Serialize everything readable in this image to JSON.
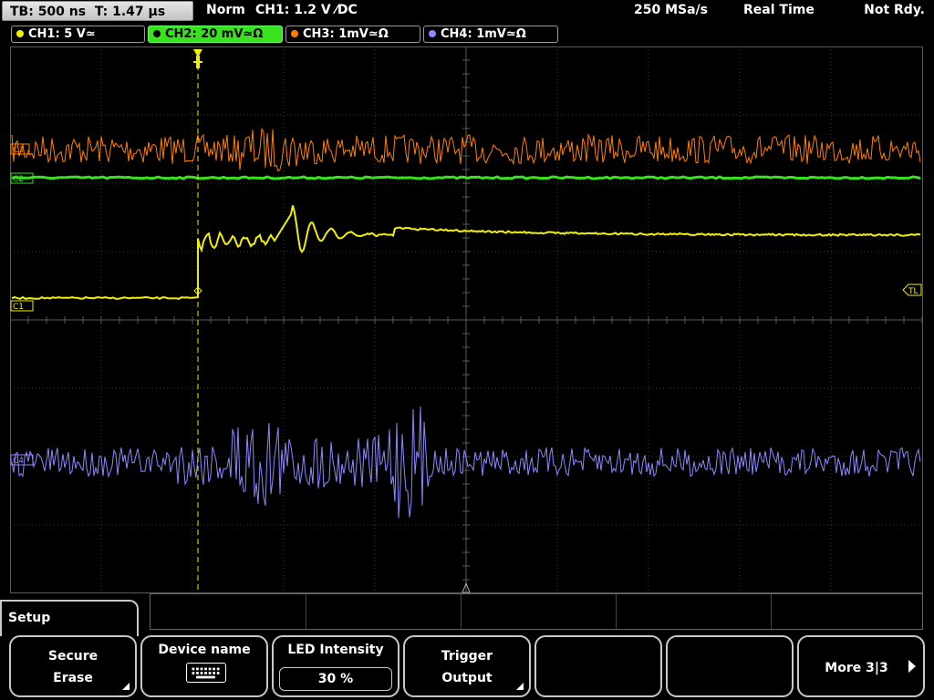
{
  "status": {
    "timebase": "TB: 500 ns",
    "trigger_time": "T: 1.47 µs",
    "mode": "Norm",
    "trigger_info": "CH1: 1.2 V ⁄DC",
    "sample_rate": "250 MSa/s",
    "acquisition": "Real Time",
    "state": "Not Rdy."
  },
  "channels": [
    {
      "label": "CH1: 5 V≃",
      "color": "#f0f000"
    },
    {
      "label": "CH2: 20 mV≃Ω",
      "color": "#39e21f"
    },
    {
      "label": "CH3: 1mV≃Ω",
      "color": "#ff8000"
    },
    {
      "label": "CH4: 1mV≃Ω",
      "color": "#8c88ff"
    }
  ],
  "markers": {
    "c1": "C1",
    "c2": "C2",
    "c3": "C3",
    "c4": "C4",
    "trigger_level": "TL"
  },
  "menu": {
    "title": "Setup",
    "softkeys": [
      {
        "line1": "Secure",
        "line2": "Erase"
      },
      {
        "line1": "Device name",
        "icon": "keyboard-icon"
      },
      {
        "line1": "LED Intensity",
        "value": "30 %"
      },
      {
        "line1": "Trigger",
        "line2": "Output"
      },
      {
        "line1": ""
      },
      {
        "line1": ""
      },
      {
        "line1": "More 3|3"
      }
    ]
  },
  "colors": {
    "grid": "#4a4a4a",
    "trigger_marker": "#f0f000",
    "ch1": "#f0f000",
    "ch2": "#39e21f",
    "ch3": "#ff8000",
    "ch4": "#8c88ff"
  }
}
